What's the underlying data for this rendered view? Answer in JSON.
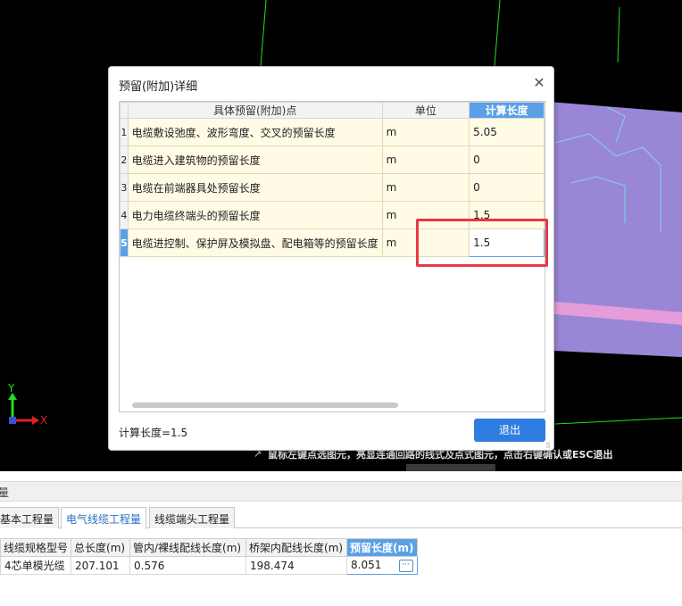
{
  "dialog": {
    "title": "预留(附加)详细",
    "close_glyph": "✕",
    "headers": {
      "point": "具体预留(附加)点",
      "unit": "单位",
      "calc": "计算长度"
    },
    "rows": [
      {
        "num": "1",
        "point": "电缆敷设弛度、波形弯度、交叉的预留长度",
        "unit": "m",
        "value": "5.05"
      },
      {
        "num": "2",
        "point": "电缆进入建筑物的预留长度",
        "unit": "m",
        "value": "0"
      },
      {
        "num": "3",
        "point": "电缆在前端器具处预留长度",
        "unit": "m",
        "value": "0"
      },
      {
        "num": "4",
        "point": "电力电缆终端头的预留长度",
        "unit": "m",
        "value": "1.5"
      },
      {
        "num": "5",
        "point": "电缆进控制、保护屏及模拟盘、配电箱等的预留长度",
        "unit": "m",
        "value": "1.5"
      }
    ],
    "footer_label": "计算长度=1.5",
    "exit_label": "退出"
  },
  "viewport": {
    "hint": "鼠标左键点选图元，亮显连通回路的线式及点式图元，点击右键确认或ESC退出",
    "axis_x": "X",
    "axis_y": "Y",
    "colors": {
      "background": "#000000",
      "green_line": "#22dd22",
      "purple_fill": "#9a86d6",
      "pink_stripe": "#f2a0d8"
    }
  },
  "lower_panel": {
    "header": "量",
    "tabs": [
      "基本工程量",
      "电气线缆工程量",
      "线缆端头工程量"
    ],
    "active_tab": 1,
    "columns": [
      "线缆规格型号",
      "总长度(m)",
      "管内/裸线配线长度(m)",
      "桥架内配线长度(m)",
      "预留长度(m)"
    ],
    "row": [
      "4芯单模光缆",
      "207.101",
      "0.576",
      "198.474",
      "8.051"
    ],
    "dots_glyph": "···"
  },
  "colors": {
    "accent": "#2f7de0",
    "highlight": "#e63946",
    "row_bg": "#fffbe5"
  }
}
